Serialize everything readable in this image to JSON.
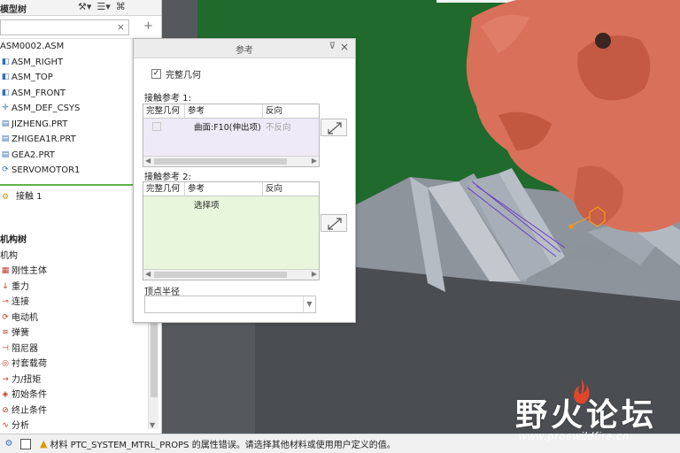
{
  "tree": {
    "title": "模型树",
    "search_clear": "×",
    "search_add": "+",
    "items": [
      {
        "label": "ASM0002.ASM",
        "icon": "assembly-icon"
      },
      {
        "label": "ASM_RIGHT",
        "icon": "datum-plane-icon"
      },
      {
        "label": "ASM_TOP",
        "icon": "datum-plane-icon"
      },
      {
        "label": "ASM_FRONT",
        "icon": "datum-plane-icon"
      },
      {
        "label": "ASM_DEF_CSYS",
        "icon": "csys-icon"
      },
      {
        "label": "JIZHENG.PRT",
        "icon": "part-icon"
      },
      {
        "label": "ZHIGEA1R.PRT",
        "icon": "part-icon"
      },
      {
        "label": "GEA2.PRT",
        "icon": "part-icon"
      },
      {
        "label": "SERVOMOTOR1",
        "icon": "servo-motor-icon"
      }
    ],
    "contact_label": "接触 1"
  },
  "mech_tree": {
    "title": "机构树",
    "root": "机构",
    "items": [
      {
        "label": "刚性主体",
        "icon": "rigid-body-icon"
      },
      {
        "label": "重力",
        "icon": "gravity-icon"
      },
      {
        "label": "连接",
        "icon": "connection-icon"
      },
      {
        "label": "电动机",
        "icon": "motor-icon"
      },
      {
        "label": "弹簧",
        "icon": "spring-icon"
      },
      {
        "label": "阻尼器",
        "icon": "damper-icon"
      },
      {
        "label": "衬套载荷",
        "icon": "bushing-icon"
      },
      {
        "label": "力/扭矩",
        "icon": "force-icon"
      },
      {
        "label": "初始条件",
        "icon": "initial-condition-icon"
      },
      {
        "label": "终止条件",
        "icon": "stop-condition-icon"
      },
      {
        "label": "分析",
        "icon": "analysis-icon"
      }
    ]
  },
  "dialog": {
    "title": "参考",
    "full_geometry_label": "完整几何",
    "full_geometry_checked": true,
    "contact_ref1_label": "接触参考 1:",
    "contact_ref2_label": "接触参考 2:",
    "columns": [
      "完整几何",
      "参考",
      "反向"
    ],
    "ref1_rows": [
      {
        "reference": "曲面:F10(伸出项)",
        "direction": "不反向"
      }
    ],
    "ref2_rows": [
      {
        "reference": "选择项",
        "direction": ""
      }
    ],
    "vertex_radius_label": "顶点半径",
    "vertex_radius_value": ""
  },
  "statusbar": {
    "message": "材料 PTC_SYSTEM_MTRL_PROPS 的属性错误。请选择其他材料或使用用户定义的值。"
  },
  "watermark": {
    "text": "野火论坛",
    "url": "www.proewildfire.cn"
  },
  "colors": {
    "ref1_row_bg": "#efeaf8",
    "ref2_row_bg": "#e8f7dc",
    "gear_color": "#d9705a",
    "rack_color": "#a5acb6",
    "backdrop_green": "#1f6a2c"
  }
}
